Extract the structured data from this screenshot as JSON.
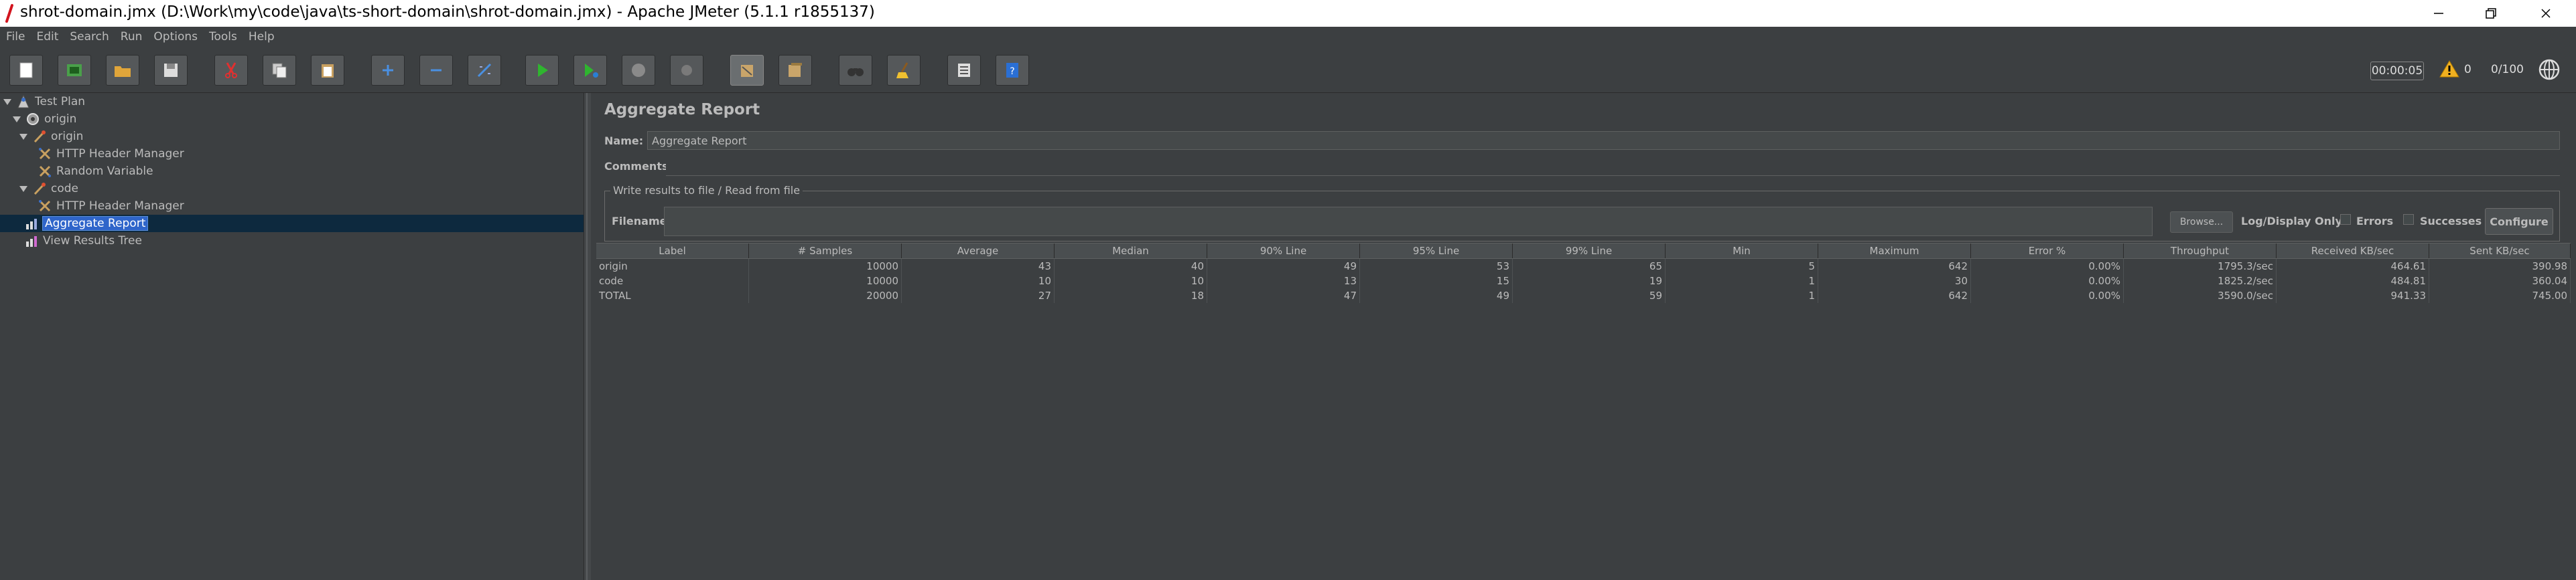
{
  "window": {
    "title": "shrot-domain.jmx (D:\\Work\\my\\code\\java\\ts-short-domain\\shrot-domain.jmx) - Apache JMeter (5.1.1 r1855137)"
  },
  "menu": [
    "File",
    "Edit",
    "Search",
    "Run",
    "Options",
    "Tools",
    "Help"
  ],
  "toolbar": {
    "timer": "00:00:05",
    "warning_count": "0",
    "threads": "0/100"
  },
  "tree": [
    {
      "label": "Test Plan",
      "icon": "test-plan-icon"
    },
    {
      "label": "origin",
      "icon": "thread-group-icon"
    },
    {
      "label": "origin",
      "icon": "http-sampler-icon"
    },
    {
      "label": "HTTP Header Manager",
      "icon": "header-manager-icon"
    },
    {
      "label": "Random Variable",
      "icon": "random-variable-icon"
    },
    {
      "label": "code",
      "icon": "http-sampler-icon"
    },
    {
      "label": "HTTP Header Manager",
      "icon": "header-manager-icon"
    },
    {
      "label": "Aggregate Report",
      "icon": "report-icon"
    },
    {
      "label": "View Results Tree",
      "icon": "results-tree-icon"
    }
  ],
  "panel": {
    "title": "Aggregate Report",
    "name_label": "Name:",
    "name_value": "Aggregate Report",
    "comments_label": "Comments:",
    "write_results_legend": "Write results to file / Read from file",
    "filename_label": "Filename",
    "browse_label": "Browse...",
    "log_display_label": "Log/Display Only:",
    "errors_label": "Errors",
    "successes_label": "Successes",
    "configure_label": "Configure"
  },
  "table": {
    "columns": [
      "Label",
      "# Samples",
      "Average",
      "Median",
      "90% Line",
      "95% Line",
      "99% Line",
      "Min",
      "Maximum",
      "Error %",
      "Throughput",
      "Received KB/sec",
      "Sent KB/sec"
    ],
    "rows": [
      [
        "origin",
        "10000",
        "43",
        "40",
        "49",
        "53",
        "65",
        "5",
        "642",
        "0.00%",
        "1795.3/sec",
        "464.61",
        "390.98"
      ],
      [
        "code",
        "10000",
        "10",
        "10",
        "13",
        "15",
        "19",
        "1",
        "30",
        "0.00%",
        "1825.2/sec",
        "484.81",
        "360.04"
      ],
      [
        "TOTAL",
        "20000",
        "27",
        "18",
        "47",
        "49",
        "59",
        "1",
        "642",
        "0.00%",
        "3590.0/sec",
        "941.33",
        "745.00"
      ]
    ]
  }
}
